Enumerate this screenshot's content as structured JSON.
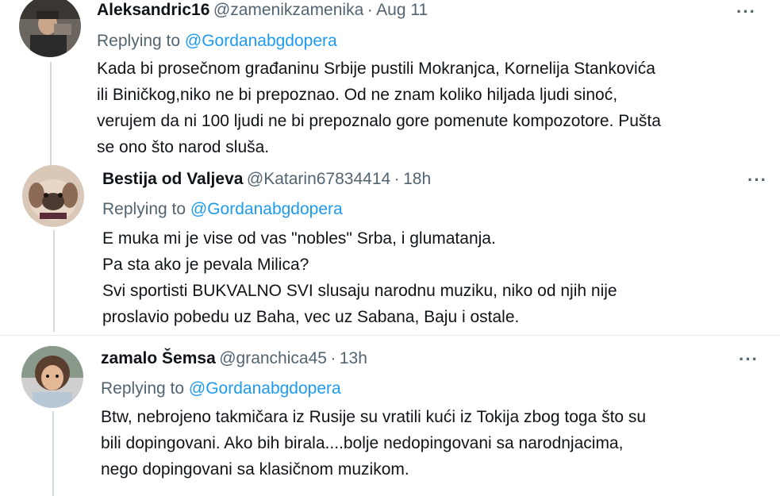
{
  "tweets": [
    {
      "name": "Aleksandric16",
      "handle": "@zamenikzamenika",
      "sep": "·",
      "time": "Aug 11",
      "replying_prefix": "Replying to",
      "replying_to": "@Gordanabgdopera",
      "lines": [
        "Kada bi prosečnom građaninu Srbije pustili Mokranjca, Kornelija Stankovića",
        "ili Biničkog,niko ne bi prepoznao. Od ne znam koliko hiljada ljudi sinoć,",
        "verujem da ni 100 ljudi ne bi prepoznalo gore pomenute kompozotore. Pušta",
        "se ono što narod sluša."
      ],
      "more": "···"
    },
    {
      "name": "Bestija od Valjeva",
      "handle": "@Katarin67834414",
      "sep": "·",
      "time": "18h",
      "replying_prefix": "Replying to",
      "replying_to": "@Gordanabgdopera",
      "lines": [
        "E muka mi je vise od vas \"nobles\" Srba, i glumatanja.",
        "Pa sta ako je pevala Milica?",
        "Svi sportisti BUKVALNO SVI slusaju narodnu muziku, niko od njih nije",
        "proslavio pobedu uz Baha, vec uz Sabana, Baju i ostale."
      ],
      "more": "···"
    },
    {
      "name": "zamalo Šemsa",
      "handle": "@granchica45",
      "sep": "·",
      "time": "13h",
      "replying_prefix": "Replying to",
      "replying_to": "@Gordanabgdopera",
      "lines": [
        "Btw, nebrojeno takmičara iz Rusije su vratili kući iz Tokija zbog toga što su",
        "bili dopingovani. Ako bih birala....bolje nedopingovani sa narodnjacima,",
        "nego dopingovani sa klasičnom muzikom."
      ],
      "more": "···"
    }
  ]
}
